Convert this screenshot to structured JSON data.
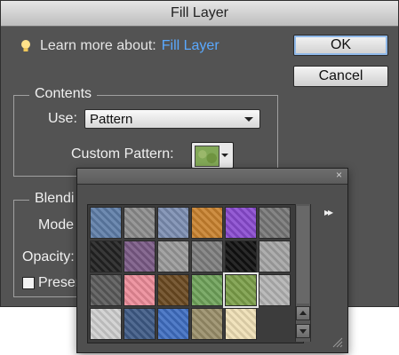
{
  "dialog": {
    "title": "Fill Layer",
    "learn_prefix": "Learn more about:",
    "learn_link": "Fill Layer",
    "ok_label": "OK",
    "cancel_label": "Cancel"
  },
  "contents": {
    "group_title": "Contents",
    "use_label": "Use:",
    "use_value": "Pattern",
    "custom_pattern_label": "Custom Pattern:"
  },
  "blending": {
    "group_title": "Blendi",
    "mode_label": "Mode",
    "opacity_label": "Opacity:",
    "preserve_label": "Preser"
  },
  "picker": {
    "close_glyph": "×",
    "menu_glyph": "▸▸",
    "patterns": [
      {
        "name": "bubbles",
        "color": "#5f7ea8"
      },
      {
        "name": "gray-noise",
        "color": "#8c8c8c"
      },
      {
        "name": "blue-fabric",
        "color": "#7d8fb2"
      },
      {
        "name": "orange-paper",
        "color": "#c9822f"
      },
      {
        "name": "rainbow",
        "color": "#8a4bd0"
      },
      {
        "name": "gray-stones",
        "color": "#777777"
      },
      {
        "name": "checker-wave",
        "color": "#222222"
      },
      {
        "name": "colorful-waves",
        "color": "#7a5a86"
      },
      {
        "name": "gray-blur",
        "color": "#9a9a9a"
      },
      {
        "name": "gray-speckle",
        "color": "#7e7e7e"
      },
      {
        "name": "black-white-stripes",
        "color": "#111111"
      },
      {
        "name": "gray-clouds",
        "color": "#a5a5a5"
      },
      {
        "name": "zebra",
        "color": "#5a5a5a"
      },
      {
        "name": "pink",
        "color": "#ec8c9a"
      },
      {
        "name": "brown-leather",
        "color": "#6b4a21"
      },
      {
        "name": "green-leaves",
        "color": "#6fa35a"
      },
      {
        "name": "grass",
        "color": "#7c9f4a"
      },
      {
        "name": "gray-granite",
        "color": "#b3b3b3"
      },
      {
        "name": "light-granite",
        "color": "#cfcfcf"
      },
      {
        "name": "denim",
        "color": "#3e5a86"
      },
      {
        "name": "blue-water",
        "color": "#3f6ec2"
      },
      {
        "name": "tan-rock",
        "color": "#9a8f6a"
      },
      {
        "name": "cream-paper",
        "color": "#efe0b6"
      }
    ],
    "selected_index": 16
  }
}
